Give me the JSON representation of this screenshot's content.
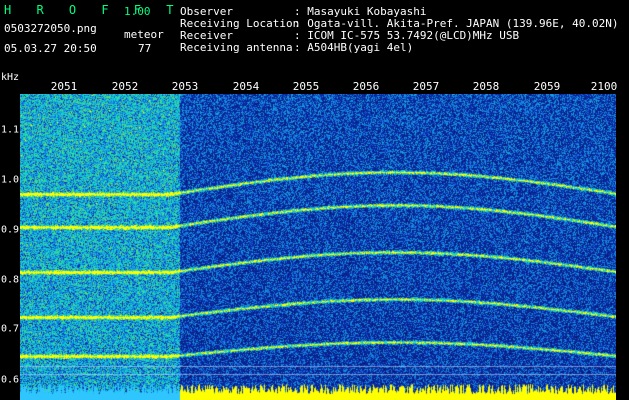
{
  "app": {
    "title": "H R O F F T",
    "version": "1.00",
    "filename": "0503272050.png",
    "mode": "meteor",
    "datetime": "05.03.27 20:50",
    "count": "77"
  },
  "info": [
    {
      "label": "Observer",
      "value": ": Masayuki Kobayashi"
    },
    {
      "label": "Receiving Location",
      "value": ": Ogata-vill. Akita-Pref. JAPAN (139.96E, 40.02N)"
    },
    {
      "label": "Receiver",
      "value": ": ICOM IC-575 53.7492(@LCD)MHz USB"
    },
    {
      "label": "Receiving antenna",
      "value": ": A504HB(yagi 4el)"
    }
  ],
  "axis": {
    "unit": "kHz",
    "time_ticks": [
      "2051",
      "2052",
      "2053",
      "2054",
      "2055",
      "2056",
      "2057",
      "2058",
      "2059",
      "2100"
    ],
    "freq_ticks": [
      "1.1",
      "1.0",
      "0.9",
      "0.8",
      "0.7",
      "0.6"
    ]
  },
  "colors": {
    "background": "#000000",
    "text": "#ffffff",
    "title": "#00ff80",
    "spectrum_low": "#0a1a8c",
    "spectrum_high": "#ffff00"
  }
}
